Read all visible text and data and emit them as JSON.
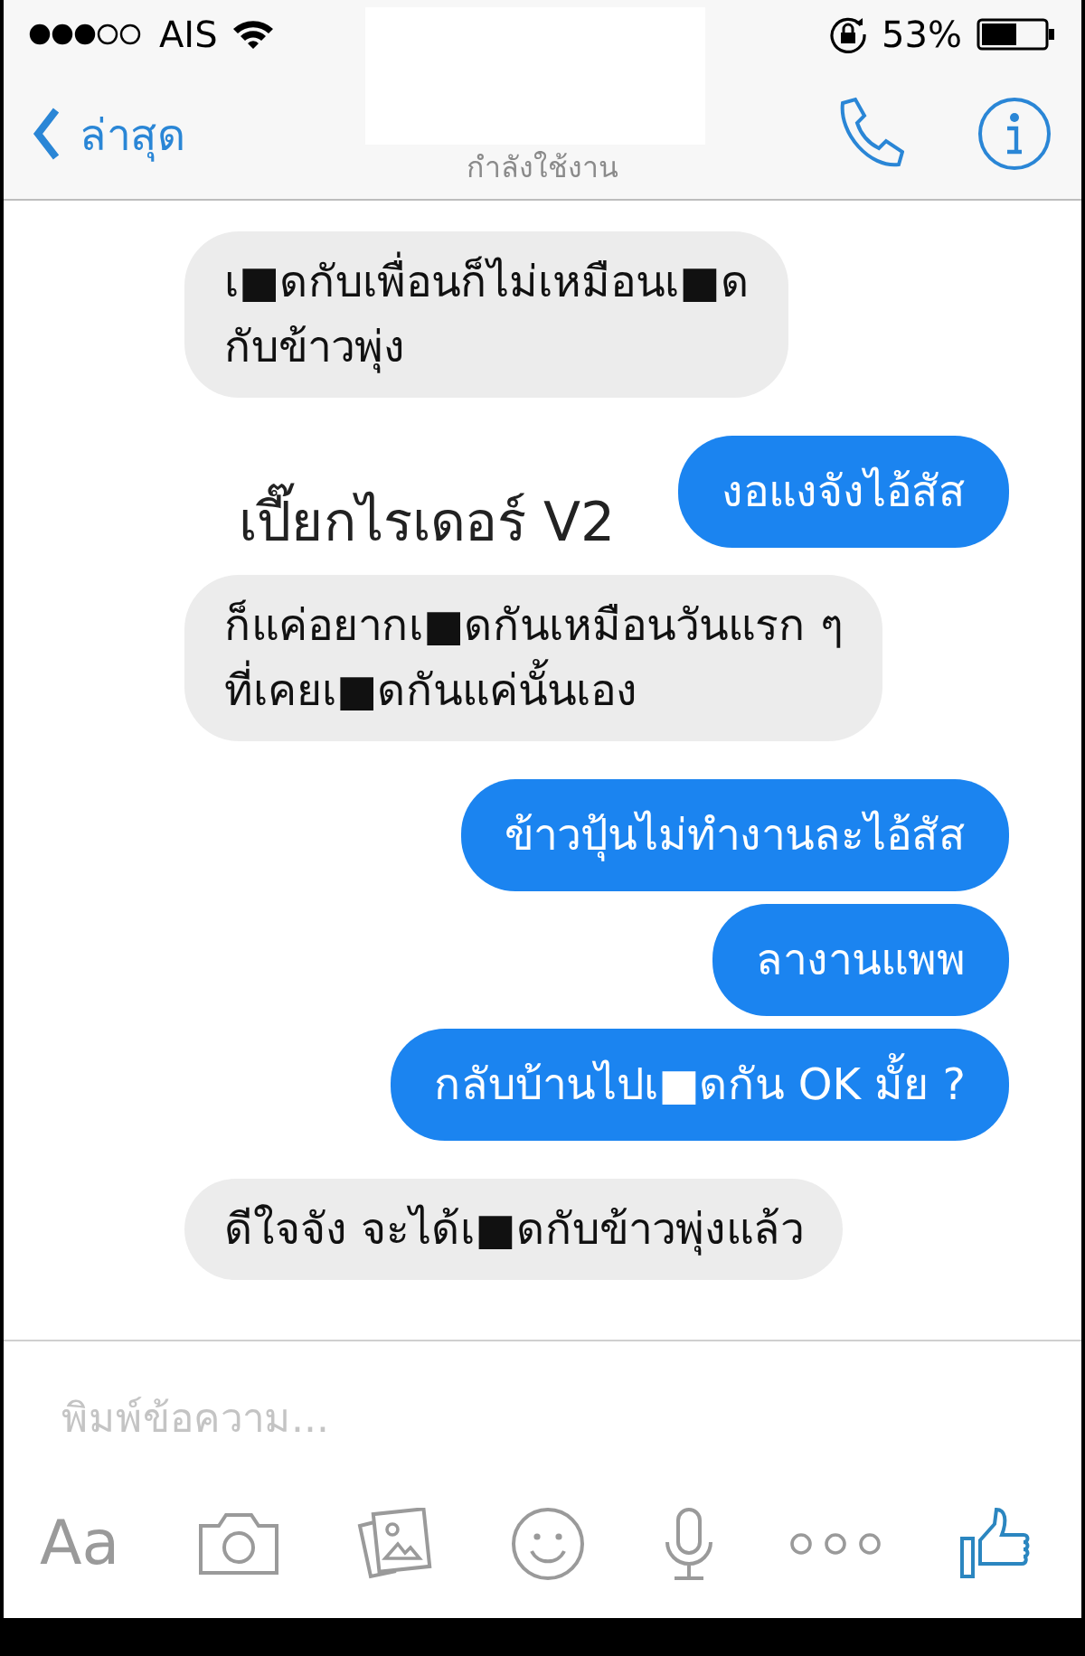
{
  "status_bar": {
    "carrier": "AIS",
    "battery": "53%"
  },
  "nav": {
    "back": "ล่าสุด",
    "subtitle": "กำลังใช้งาน"
  },
  "messages": [
    {
      "kind": "received",
      "text": "เ■ดกับเพื่อนก็ไม่เหมือนเ■ด\nกับข้าวพุ่ง"
    },
    {
      "kind": "sent",
      "text": "งอแงจังไอ้สัส"
    },
    {
      "kind": "overlay_text",
      "text": "เปี๊ยกไรเดอร์ V2"
    },
    {
      "kind": "received",
      "text": "ก็แค่อยากเ■ดกันเหมือนวันแรก ๆ\nที่เคยเ■ดกันแค่นั้นเอง"
    },
    {
      "kind": "sent",
      "text": "ข้าวปุ้นไม่ทำงานละไอ้สัส"
    },
    {
      "kind": "sent",
      "text": "ลางานแพพ"
    },
    {
      "kind": "sent",
      "text": "กลับบ้านไปเ■ดกัน OK มั้ย ?"
    },
    {
      "kind": "received",
      "text": "ดีใจจัง จะได้เ■ดกับข้าวพุ่งแล้ว"
    }
  ],
  "composer": {
    "placeholder": "พิมพ์ข้อความ...",
    "text_button": "Aa"
  }
}
